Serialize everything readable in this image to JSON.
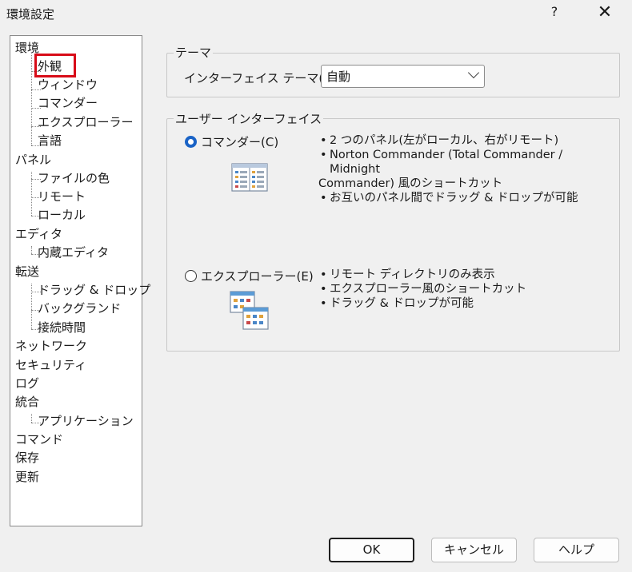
{
  "window": {
    "title": "環境設定",
    "help_label": "?",
    "close_label": "✕"
  },
  "tree": {
    "items": [
      {
        "label": "環境",
        "level": 1
      },
      {
        "label": "外観",
        "level": 2,
        "selected": true
      },
      {
        "label": "ウィンドウ",
        "level": 2
      },
      {
        "label": "コマンダー",
        "level": 2
      },
      {
        "label": "エクスプローラー",
        "level": 2
      },
      {
        "label": "言語",
        "level": 2
      },
      {
        "label": "パネル",
        "level": 1
      },
      {
        "label": "ファイルの色",
        "level": 2
      },
      {
        "label": "リモート",
        "level": 2
      },
      {
        "label": "ローカル",
        "level": 2
      },
      {
        "label": "エディタ",
        "level": 1
      },
      {
        "label": "内蔵エディタ",
        "level": 2
      },
      {
        "label": "転送",
        "level": 1
      },
      {
        "label": "ドラッグ & ドロップ",
        "level": 2
      },
      {
        "label": "バックグランド",
        "level": 2
      },
      {
        "label": "接続時間",
        "level": 2
      },
      {
        "label": "ネットワーク",
        "level": 1
      },
      {
        "label": "セキュリティ",
        "level": 1
      },
      {
        "label": "ログ",
        "level": 1
      },
      {
        "label": "統合",
        "level": 1
      },
      {
        "label": "アプリケーション",
        "level": 2
      },
      {
        "label": "コマンド",
        "level": 1
      },
      {
        "label": "保存",
        "level": 1
      },
      {
        "label": "更新",
        "level": 1
      }
    ]
  },
  "theme": {
    "group_label": "テーマ",
    "field_label": "インターフェイス テーマ(T):",
    "value": "自動"
  },
  "ui": {
    "group_label": "ユーザー インターフェイス",
    "commander": {
      "label": "コマンダー(C)",
      "selected": true,
      "bullets": [
        "2 つのパネル(左がローカル、右がリモート)",
        "Norton Commander (Total Commander / Midnight",
        "Commander) 風のショートカット",
        "お互いのパネル間でドラッグ & ドロップが可能"
      ]
    },
    "explorer": {
      "label": "エクスプローラー(E)",
      "selected": false,
      "bullets": [
        "リモート ディレクトリのみ表示",
        "エクスプローラー風のショートカット",
        "ドラッグ & ドロップが可能"
      ]
    }
  },
  "buttons": {
    "ok": "OK",
    "cancel": "キャンセル",
    "help": "ヘルプ"
  },
  "colors": {
    "selection_highlight": "#d80c18",
    "radio_accent": "#1a63c6"
  }
}
